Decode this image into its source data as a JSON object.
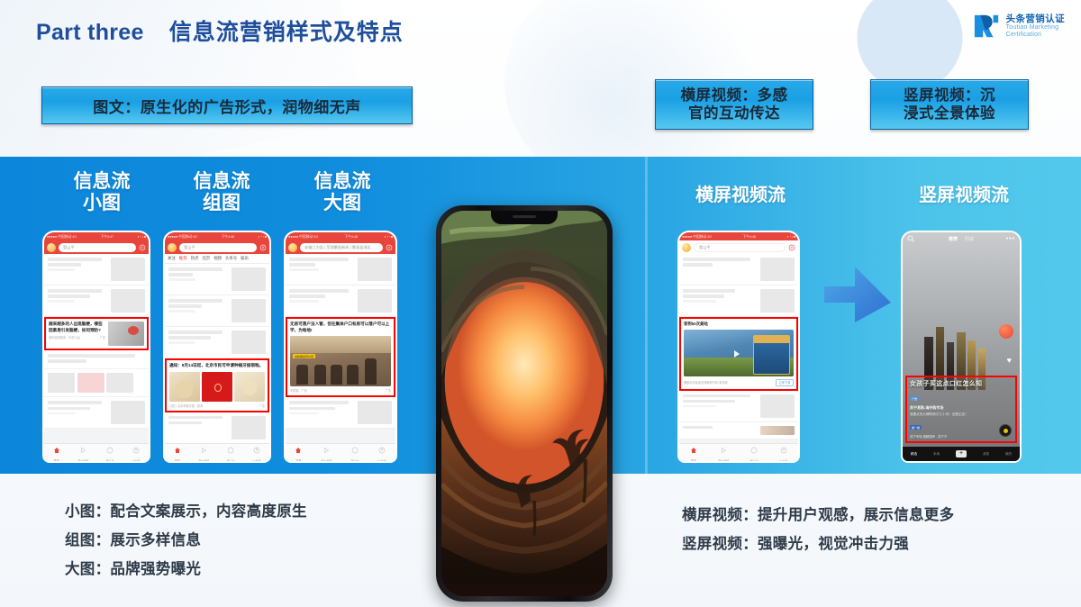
{
  "header": {
    "title_en": "Part three",
    "title_cn": "信息流营销样式及特点",
    "logo_cn": "头条营销认证",
    "logo_en_line1": "Toutiao Marketing",
    "logo_en_line2": "Certification"
  },
  "chips": {
    "image_text": "图文：原生化的广告形式，润物细无声",
    "horizontal_video_l1": "横屏视频：多感",
    "horizontal_video_l2": "官的互动传达",
    "vertical_video_l1": "竖屏视频：沉",
    "vertical_video_l2": "浸式全景体验"
  },
  "columns": [
    {
      "id": "feed-small",
      "line1": "信息流",
      "line2": "小图"
    },
    {
      "id": "feed-group",
      "line1": "信息流",
      "line2": "组图"
    },
    {
      "id": "feed-big",
      "line1": "信息流",
      "line2": "大图"
    },
    {
      "id": "horizontal-video-feed",
      "line1": "横屏视频流",
      "line2": ""
    },
    {
      "id": "vertical-video-feed",
      "line1": "竖屏视频流",
      "line2": ""
    }
  ],
  "phones": {
    "small": {
      "status_left": "●●●●● 中国移动 4G",
      "status_center": "下午4:47",
      "status_right": "◑ ↑↓ ■",
      "search_placeholder": "登山平",
      "ad_title": "越来越多的人出现脑梗，哪些因素易引发脑梗，如何预防?",
      "ad_meta_left": "某科健康管家 · 59岁以后",
      "ad_meta_right": "广告"
    },
    "group": {
      "status_left": "●●●●● 中国移动 4G",
      "status_center": "下午4:48",
      "status_right": "◑ ↑↓ ■",
      "search_placeholder": "登山平",
      "nav_tabs": [
        "关注",
        "推荐",
        "热点",
        "北京",
        "视频",
        "头条号",
        "娱乐"
      ],
      "nav_active": "推荐",
      "ad_title": "通知：8月14日起，北京市民可申请种植牙报销啦。",
      "ad_meta_left": "口腔 | 北京种植牙报 · 新闻",
      "ad_meta_right": "广告"
    },
    "big": {
      "status_left": "●●●●● 中国移动 4G",
      "status_center": "下午4:48",
      "status_right": "◑ ↑↓ ■",
      "search_placeholder": "安徽几为县 | 芜湖繁昌新闻 | 繁昌县改区",
      "ad_title": "无房可落户没人管，但在集体户口有房可以落户可以上学，为啥地!",
      "ad_badge": "最新解读有价值",
      "ad_meta_left": "安居客 · 广告",
      "ad_meta_right": "广告"
    },
    "horizontal": {
      "status_left": "●●●●● 中国移动 4G",
      "status_center": "下午4:48",
      "status_right": "◑ ↑↓ ■",
      "search_placeholder": "登山平",
      "ad_title": "穿到50次美哒",
      "ad_meta_left": "爆款武将免费送领取即可玩·新游戏",
      "ad_button": "立即下载"
    },
    "vertical": {
      "nav_tabs": [
        "推荐",
        "同城"
      ],
      "nav_active": "推荐",
      "ad_headline": "女孩子买这点口红怎么知",
      "ad_badge": "广告",
      "ad_account": "苏宁易购-海外购专场",
      "ad_desc": "我要买的大牌购物才几十块！全是正品！",
      "ad_tag": "看一看",
      "ad_music": "苏宁专场  视频原声 - 苏宁宁",
      "bottom_tabs": [
        "精选",
        "本地",
        "+",
        "消息",
        "我的"
      ]
    }
  },
  "bottom_left_lines": [
    "小图：配合文案展示，内容高度原生",
    "组图：展示多样信息",
    "大图：品牌强势曝光"
  ],
  "bottom_right_lines": [
    "横屏视频：提升用户观感，展示信息更多",
    "竖屏视频：强曝光，视觉冲击力强"
  ],
  "colors": {
    "title_blue": "#1f4e9c",
    "band_left": "#0c86da",
    "band_right": "#52c9ec",
    "chip_fill": "#1aa0e4",
    "ad_highlight": "#ff0000",
    "body_text": "#2f3b49"
  }
}
